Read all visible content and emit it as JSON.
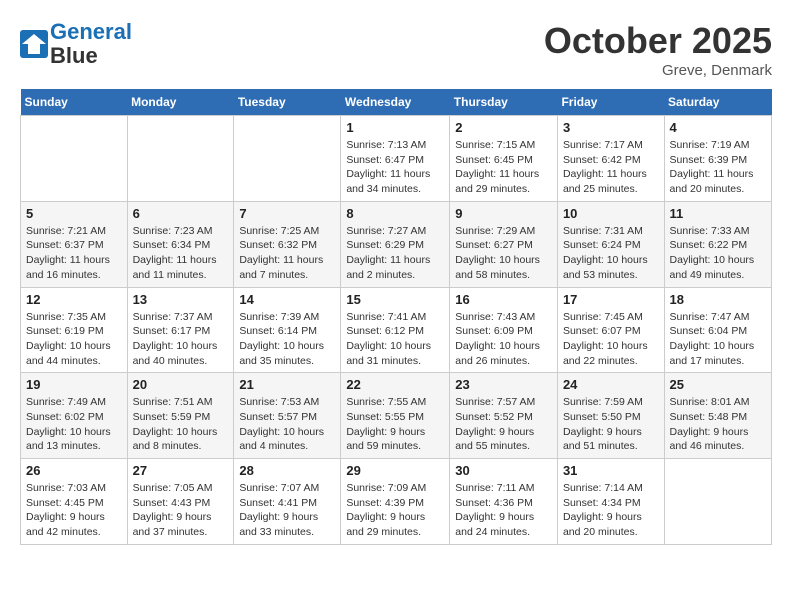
{
  "header": {
    "logo_line1": "General",
    "logo_line2": "Blue",
    "month": "October 2025",
    "location": "Greve, Denmark"
  },
  "weekdays": [
    "Sunday",
    "Monday",
    "Tuesday",
    "Wednesday",
    "Thursday",
    "Friday",
    "Saturday"
  ],
  "weeks": [
    [
      {
        "day": "",
        "info": ""
      },
      {
        "day": "",
        "info": ""
      },
      {
        "day": "",
        "info": ""
      },
      {
        "day": "1",
        "info": "Sunrise: 7:13 AM\nSunset: 6:47 PM\nDaylight: 11 hours and 34 minutes."
      },
      {
        "day": "2",
        "info": "Sunrise: 7:15 AM\nSunset: 6:45 PM\nDaylight: 11 hours and 29 minutes."
      },
      {
        "day": "3",
        "info": "Sunrise: 7:17 AM\nSunset: 6:42 PM\nDaylight: 11 hours and 25 minutes."
      },
      {
        "day": "4",
        "info": "Sunrise: 7:19 AM\nSunset: 6:39 PM\nDaylight: 11 hours and 20 minutes."
      }
    ],
    [
      {
        "day": "5",
        "info": "Sunrise: 7:21 AM\nSunset: 6:37 PM\nDaylight: 11 hours and 16 minutes."
      },
      {
        "day": "6",
        "info": "Sunrise: 7:23 AM\nSunset: 6:34 PM\nDaylight: 11 hours and 11 minutes."
      },
      {
        "day": "7",
        "info": "Sunrise: 7:25 AM\nSunset: 6:32 PM\nDaylight: 11 hours and 7 minutes."
      },
      {
        "day": "8",
        "info": "Sunrise: 7:27 AM\nSunset: 6:29 PM\nDaylight: 11 hours and 2 minutes."
      },
      {
        "day": "9",
        "info": "Sunrise: 7:29 AM\nSunset: 6:27 PM\nDaylight: 10 hours and 58 minutes."
      },
      {
        "day": "10",
        "info": "Sunrise: 7:31 AM\nSunset: 6:24 PM\nDaylight: 10 hours and 53 minutes."
      },
      {
        "day": "11",
        "info": "Sunrise: 7:33 AM\nSunset: 6:22 PM\nDaylight: 10 hours and 49 minutes."
      }
    ],
    [
      {
        "day": "12",
        "info": "Sunrise: 7:35 AM\nSunset: 6:19 PM\nDaylight: 10 hours and 44 minutes."
      },
      {
        "day": "13",
        "info": "Sunrise: 7:37 AM\nSunset: 6:17 PM\nDaylight: 10 hours and 40 minutes."
      },
      {
        "day": "14",
        "info": "Sunrise: 7:39 AM\nSunset: 6:14 PM\nDaylight: 10 hours and 35 minutes."
      },
      {
        "day": "15",
        "info": "Sunrise: 7:41 AM\nSunset: 6:12 PM\nDaylight: 10 hours and 31 minutes."
      },
      {
        "day": "16",
        "info": "Sunrise: 7:43 AM\nSunset: 6:09 PM\nDaylight: 10 hours and 26 minutes."
      },
      {
        "day": "17",
        "info": "Sunrise: 7:45 AM\nSunset: 6:07 PM\nDaylight: 10 hours and 22 minutes."
      },
      {
        "day": "18",
        "info": "Sunrise: 7:47 AM\nSunset: 6:04 PM\nDaylight: 10 hours and 17 minutes."
      }
    ],
    [
      {
        "day": "19",
        "info": "Sunrise: 7:49 AM\nSunset: 6:02 PM\nDaylight: 10 hours and 13 minutes."
      },
      {
        "day": "20",
        "info": "Sunrise: 7:51 AM\nSunset: 5:59 PM\nDaylight: 10 hours and 8 minutes."
      },
      {
        "day": "21",
        "info": "Sunrise: 7:53 AM\nSunset: 5:57 PM\nDaylight: 10 hours and 4 minutes."
      },
      {
        "day": "22",
        "info": "Sunrise: 7:55 AM\nSunset: 5:55 PM\nDaylight: 9 hours and 59 minutes."
      },
      {
        "day": "23",
        "info": "Sunrise: 7:57 AM\nSunset: 5:52 PM\nDaylight: 9 hours and 55 minutes."
      },
      {
        "day": "24",
        "info": "Sunrise: 7:59 AM\nSunset: 5:50 PM\nDaylight: 9 hours and 51 minutes."
      },
      {
        "day": "25",
        "info": "Sunrise: 8:01 AM\nSunset: 5:48 PM\nDaylight: 9 hours and 46 minutes."
      }
    ],
    [
      {
        "day": "26",
        "info": "Sunrise: 7:03 AM\nSunset: 4:45 PM\nDaylight: 9 hours and 42 minutes."
      },
      {
        "day": "27",
        "info": "Sunrise: 7:05 AM\nSunset: 4:43 PM\nDaylight: 9 hours and 37 minutes."
      },
      {
        "day": "28",
        "info": "Sunrise: 7:07 AM\nSunset: 4:41 PM\nDaylight: 9 hours and 33 minutes."
      },
      {
        "day": "29",
        "info": "Sunrise: 7:09 AM\nSunset: 4:39 PM\nDaylight: 9 hours and 29 minutes."
      },
      {
        "day": "30",
        "info": "Sunrise: 7:11 AM\nSunset: 4:36 PM\nDaylight: 9 hours and 24 minutes."
      },
      {
        "day": "31",
        "info": "Sunrise: 7:14 AM\nSunset: 4:34 PM\nDaylight: 9 hours and 20 minutes."
      },
      {
        "day": "",
        "info": ""
      }
    ]
  ]
}
